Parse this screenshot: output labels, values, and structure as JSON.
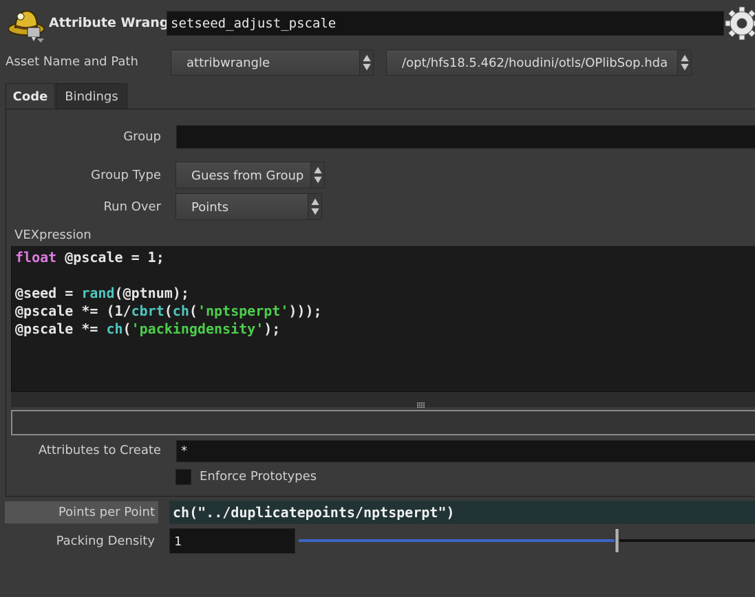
{
  "header": {
    "node_type": "Attribute Wrangle",
    "node_name": "setseed_adjust_pscale",
    "node_icon": "wrangle-cowboy-hat-icon",
    "gear_icon": "gear-icon"
  },
  "asset": {
    "label": "Asset Name and Path",
    "name_value": "attribwrangle",
    "path_value": "/opt/hfs18.5.462/houdini/otls/OPlibSop.hda"
  },
  "tabs": [
    {
      "label": "Code",
      "active": true
    },
    {
      "label": "Bindings",
      "active": false
    }
  ],
  "group": {
    "label": "Group",
    "value": ""
  },
  "group_type": {
    "label": "Group Type",
    "value": "Guess from Group"
  },
  "run_over": {
    "label": "Run Over",
    "value": "Points"
  },
  "vex": {
    "label": "VEXpression",
    "lines": [
      [
        [
          "kw",
          "float"
        ],
        [
          "t",
          " @pscale = 1;"
        ]
      ],
      [],
      [
        [
          "t",
          "@seed = "
        ],
        [
          "fn",
          "rand"
        ],
        [
          "t",
          "(@ptnum);"
        ]
      ],
      [
        [
          "t",
          "@pscale *= (1/"
        ],
        [
          "fn",
          "cbrt"
        ],
        [
          "t",
          "("
        ],
        [
          "fn",
          "ch"
        ],
        [
          "t",
          "("
        ],
        [
          "str",
          "'nptsperpt'"
        ],
        [
          "t",
          ")));"
        ]
      ],
      [
        [
          "t",
          "@pscale *= "
        ],
        [
          "fn",
          "ch"
        ],
        [
          "t",
          "("
        ],
        [
          "str",
          "'packingdensity'"
        ],
        [
          "t",
          ");"
        ]
      ]
    ]
  },
  "attributes_to_create": {
    "label": "Attributes to Create",
    "value": "*"
  },
  "enforce_prototypes": {
    "label": "Enforce Prototypes",
    "checked": false
  },
  "points_per_point": {
    "label": "Points per Point",
    "value": "ch(\"../duplicatepoints/nptsperpt\")"
  },
  "packing_density": {
    "label": "Packing Density",
    "value": "1",
    "slider_fraction": 0.69
  },
  "colors": {
    "keyword": "#e07be0",
    "function": "#4fc8c0",
    "string": "#4ccf4c",
    "expression_bg": "#213335",
    "slider_fill": "#3b66c7"
  }
}
